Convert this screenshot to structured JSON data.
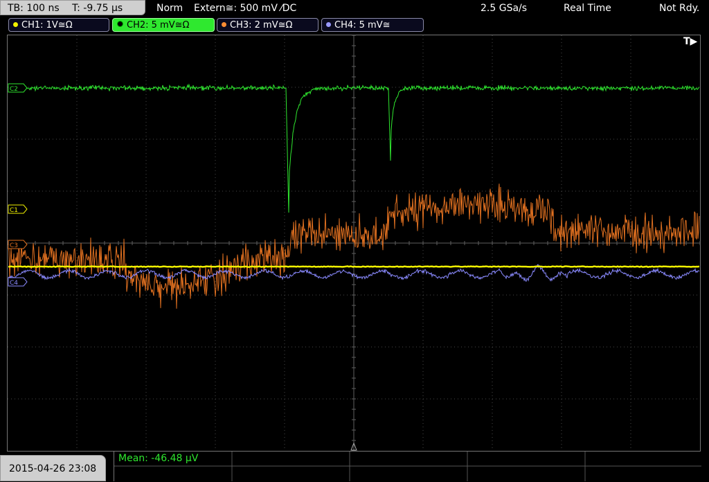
{
  "topbar": {
    "timebase": "TB: 100 ns",
    "trigger_pos": "T: -9.75 µs",
    "mode": "Norm",
    "trigger_source": "Extern≅: 500 mV ⁄DC",
    "sample_rate": "2.5 GSa/s",
    "acq_mode": "Real Time",
    "status": "Not Rdy."
  },
  "channels": [
    {
      "label": "CH1: 1V≅Ω",
      "color": "#f2f200"
    },
    {
      "label": "CH2: 5 mV≅Ω",
      "color": "#2fe82f"
    },
    {
      "label": "CH3: 2 mV≅Ω",
      "color": "#ff8c33"
    },
    {
      "label": "CH4: 5 mV≅",
      "color": "#9999ff"
    }
  ],
  "markers": {
    "c1": "C1",
    "c2": "C2",
    "c3": "C3",
    "c4": "C4",
    "trigger": "T▶"
  },
  "bottom": {
    "datetime": "2015-04-26 23:08",
    "measurement": "Mean: -46.48 µV"
  },
  "colors": {
    "ch1": "#f2f200",
    "ch2": "#2fe82f",
    "ch3": "#e07020",
    "ch4": "#8a8aff",
    "grid": "#555555"
  }
}
